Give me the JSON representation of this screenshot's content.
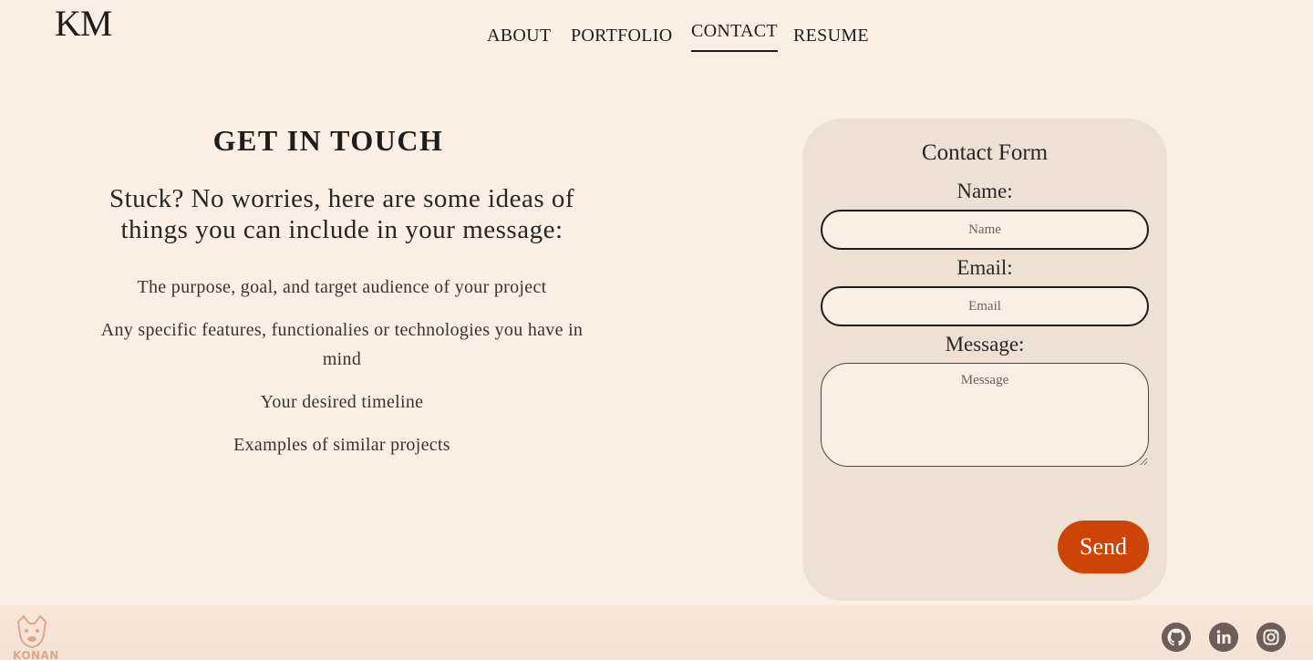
{
  "header": {
    "logo": "KM",
    "nav": [
      "ABOUT",
      "PORTFOLIO",
      "CONTACT",
      "RESUME"
    ],
    "active_tab": "CONTACT"
  },
  "contact_intro": {
    "title": "GET IN TOUCH",
    "subtitle": "Stuck? No worries, here are some ideas of things you can include in your message:",
    "ideas": [
      "The purpose, goal, and target audience of your project",
      "Any specific features, functionalies or technologies you have in mind",
      "Your desired timeline",
      "Examples of similar projects"
    ]
  },
  "form": {
    "title": "Contact Form",
    "name_label": "Name:",
    "name_placeholder": "Name",
    "email_label": "Email:",
    "email_placeholder": "Email",
    "message_label": "Message:",
    "message_placeholder": "Message",
    "send_label": "Send"
  },
  "footer": {
    "brand_text": "KONAN",
    "social_icons": [
      "github-icon",
      "linkedin-icon",
      "instagram-icon"
    ]
  },
  "colors": {
    "background": "#fbefe4",
    "card": "#efe0d4",
    "accent": "#cd4407",
    "text": "#1f1c1a",
    "icon": "#6e5e5a"
  }
}
